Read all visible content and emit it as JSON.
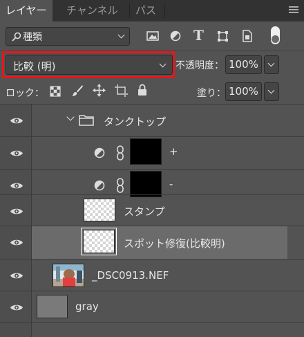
{
  "tabs": [
    {
      "label": "レイヤー",
      "active": true
    },
    {
      "label": "チャンネル",
      "active": false
    },
    {
      "label": "パス",
      "active": false
    }
  ],
  "filter": {
    "label": "種類"
  },
  "blend_mode": {
    "value": "比較 (明)",
    "highlight_color": "#e8151b"
  },
  "opacity": {
    "label": "不透明度：",
    "value": "100%"
  },
  "lock": {
    "label": "ロック："
  },
  "fill": {
    "label": "塗り：",
    "value": "100%"
  },
  "layers": [
    {
      "name": "タンクトップ",
      "type": "group",
      "expanded": true
    },
    {
      "name": "+",
      "type": "adjustment"
    },
    {
      "name": "-",
      "type": "adjustment"
    },
    {
      "name": "スタンプ",
      "type": "pixel"
    },
    {
      "name": "スポット修復(比較明)",
      "type": "pixel",
      "selected": true
    },
    {
      "name": "_DSC0913.NEF",
      "type": "photo"
    },
    {
      "name": "gray",
      "type": "fill"
    }
  ],
  "colors": {
    "panel": "#535353",
    "tab_bar": "#323232",
    "selected_row": "#6b6b6b"
  }
}
